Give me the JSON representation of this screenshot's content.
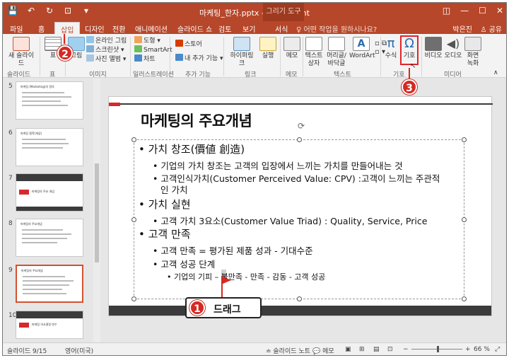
{
  "window": {
    "title": "마케팅_한자.pptx - PowerPoint",
    "context_tab": "그리기 도구",
    "controls": [
      "◫",
      "—",
      "☐",
      "✕"
    ]
  },
  "qat": {
    "save": "💾",
    "undo": "↶",
    "redo": "↻",
    "present": "⊡",
    "more": "▾"
  },
  "tabs": [
    "파일",
    "홈",
    "삽입",
    "디자인",
    "전환",
    "애니메이션",
    "슬라이드 쇼",
    "검토",
    "보기",
    "서식"
  ],
  "tell_me": "♀ 어떤 작업을 원하시나요?",
  "user": "박은진",
  "share": "♙ 공유",
  "ribbon": {
    "new_slide": "새 슬라이드",
    "table": "표",
    "images": [
      "그림",
      "온라인 그림",
      "스크린샷 ▾",
      "사진 앨범 ▾"
    ],
    "illustrations": [
      "도형 ▾",
      "SmartArt",
      "차트"
    ],
    "addins": [
      "스토어",
      "내 추가 기능 ▾"
    ],
    "links": [
      "하이퍼링크",
      "실행"
    ],
    "comment": "메모",
    "text": [
      "텍스트 상자",
      "머리글/ 바닥글",
      "WordArt"
    ],
    "symbols": [
      "수식",
      "기호"
    ],
    "media": [
      "비디오",
      "오디오",
      "화면 녹화"
    ],
    "groups": [
      "슬라이드",
      "표",
      "이미지",
      "일러스트레이션",
      "추가 기능",
      "링크",
      "메모",
      "텍스트",
      "기호",
      "미디어"
    ]
  },
  "callouts": {
    "one": "1",
    "two": "2",
    "three": "3",
    "drag": "드래그"
  },
  "thumbnails": [
    {
      "num": "5",
      "title": "마케팅 (Marketing)의 정의"
    },
    {
      "num": "6",
      "title": "마케팅 철학(개념)"
    },
    {
      "num": "7",
      "title": "마케팅의 주요 개념"
    },
    {
      "num": "8",
      "title": "마케팅의 주요개념"
    },
    {
      "num": "9",
      "title": "마케팅의 주요개념"
    },
    {
      "num": "10",
      "title": "마케팅 의사결정 변수"
    }
  ],
  "slide": {
    "title": "마케팅의 주요개념",
    "bullets": [
      "• 가치 창조(價値 創造)",
      "• 기업의 가치 창조는 고객의 입장에서 느끼는 가치를 만들어내는 것",
      "• 고객인식가치(Customer Perceived Value: CPV) :고객이 느끼는 주관적",
      "인 가치",
      "• 가치 실현",
      "• 고객 가치 3요소(Customer Value Triad) : Quality, Service, Price",
      "• 고객 만족",
      "• 고객 만족 = 평가된 제품 성과 - 기대수준",
      "• 고객 성공 단계",
      "• 기업의 기피 – 불만족 - 만족 - 감동 - 고객 성공"
    ]
  },
  "status": {
    "slide": "슬라이드 9/15",
    "lang": "영어(미국)",
    "notes": "≐ 슬라이드 노트",
    "comments": "💬 메모",
    "zoom": "66 %"
  }
}
